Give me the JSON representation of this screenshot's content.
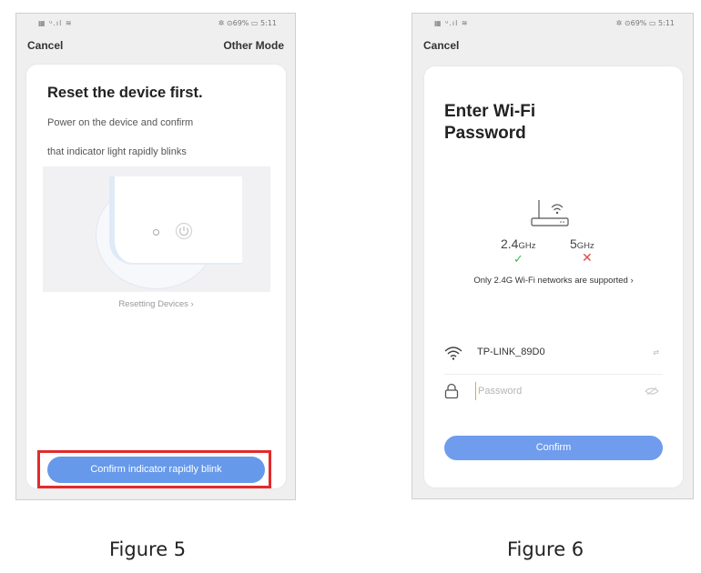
{
  "figure5": {
    "status_left": "▦ ᵘ.ıl ≋",
    "status_right": "✲ ⊙69% ▭ 5:11",
    "nav": {
      "cancel": "Cancel",
      "other_mode": "Other Mode"
    },
    "title": "Reset the device first.",
    "description_line1": "Power on the device and confirm",
    "description_line2": "that indicator light rapidly blinks",
    "resetting_link": "Resetting Devices  ›",
    "confirm_button": "Confirm indicator rapidly blink",
    "caption": "Figure 5"
  },
  "figure6": {
    "status_left": "▦ ᵘ.ıl ≋",
    "status_right": "✲ ⊙69% ▭ 5:11",
    "nav": {
      "cancel": "Cancel"
    },
    "title_line1": "Enter Wi-Fi",
    "title_line2": "Password",
    "band_24": {
      "number": "2.4",
      "unit": "GHz"
    },
    "band_5": {
      "number": "5",
      "unit": "GHz"
    },
    "band_24_status": "✓",
    "band_5_status": "✕",
    "support_note": "Only 2.4G Wi-Fi networks are supported  ›",
    "wifi_name": "TP-LINK_89D0",
    "switch_label": "⇄",
    "password_placeholder": "Password",
    "confirm_button": "Confirm",
    "caption": "Figure 6"
  },
  "colors": {
    "primary_button": "#6699ea",
    "highlight_box": "#e22b2b",
    "check": "#3dbb4f",
    "cross": "#e04a4a"
  }
}
